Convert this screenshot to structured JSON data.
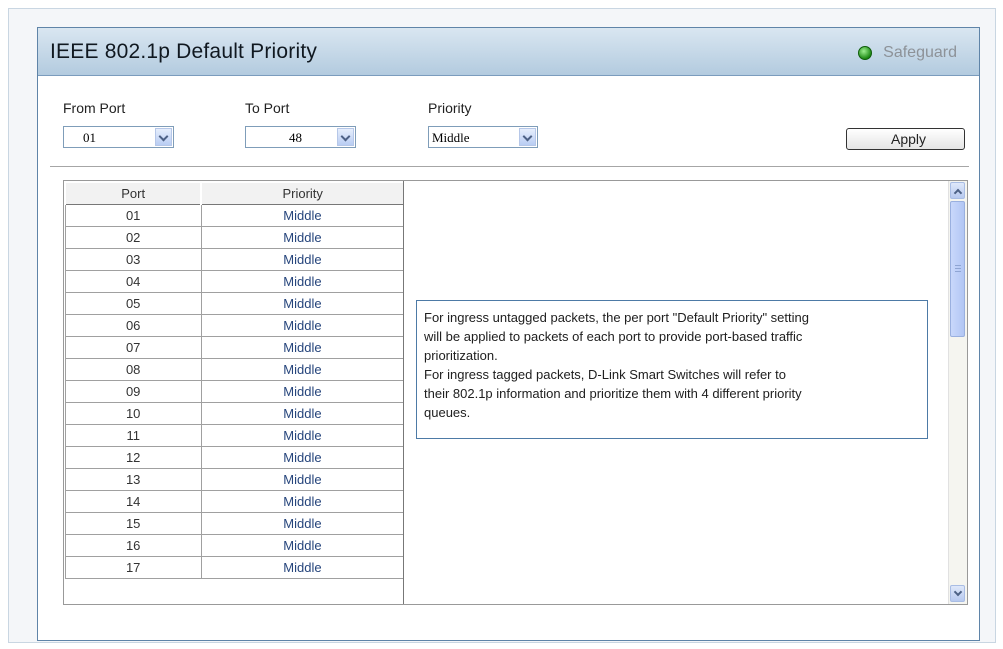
{
  "header": {
    "title": "IEEE 802.1p Default Priority",
    "safeguard_label": "Safeguard"
  },
  "form": {
    "from_port": {
      "label": "From Port",
      "value": "01"
    },
    "to_port": {
      "label": "To Port",
      "value": "48"
    },
    "priority": {
      "label": "Priority",
      "value": "Middle"
    },
    "apply_label": "Apply"
  },
  "table": {
    "headers": [
      "Port",
      "Priority"
    ],
    "rows": [
      [
        "01",
        "Middle"
      ],
      [
        "02",
        "Middle"
      ],
      [
        "03",
        "Middle"
      ],
      [
        "04",
        "Middle"
      ],
      [
        "05",
        "Middle"
      ],
      [
        "06",
        "Middle"
      ],
      [
        "07",
        "Middle"
      ],
      [
        "08",
        "Middle"
      ],
      [
        "09",
        "Middle"
      ],
      [
        "10",
        "Middle"
      ],
      [
        "11",
        "Middle"
      ],
      [
        "12",
        "Middle"
      ],
      [
        "13",
        "Middle"
      ],
      [
        "14",
        "Middle"
      ],
      [
        "15",
        "Middle"
      ],
      [
        "16",
        "Middle"
      ],
      [
        "17",
        "Middle"
      ]
    ]
  },
  "help_lines": [
    "For ingress untagged packets, the per port \"Default Priority\" setting",
    "will be applied to packets of each port to provide port-based traffic",
    "prioritization.",
    "For ingress tagged packets, D-Link Smart Switches will refer to",
    "their 802.1p information and prioritize them with 4 different priority",
    "queues."
  ],
  "colors": {
    "title_bar": "#b3cbdf",
    "panel_border": "#5f84a8",
    "priority_text": "#26457c",
    "safeguard_indicator": "#1e8a15"
  },
  "icons": {
    "safeguard": "green-status-dot-icon",
    "dropdown": "chevron-down-icon",
    "scroll_up": "chevron-up-icon",
    "scroll_down": "chevron-down-icon"
  }
}
